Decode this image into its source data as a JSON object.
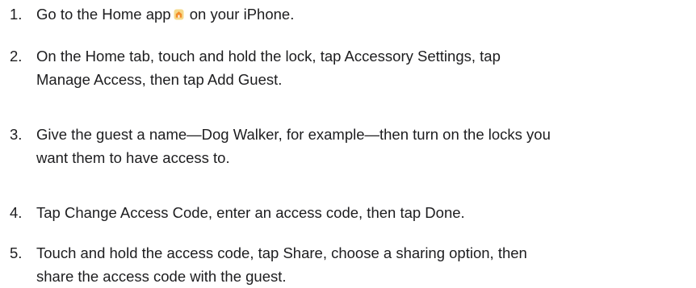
{
  "steps": [
    {
      "number": "1.",
      "text_before_icon": "Go to the Home app",
      "icon": "home-app-icon",
      "text_after_icon": "on your iPhone."
    },
    {
      "number": "2.",
      "line1": "On the Home tab, touch and hold the lock, tap Accessory Settings, tap",
      "line2": "Manage Access, then tap Add Guest."
    },
    {
      "number": "3.",
      "line1": "Give the guest a name—Dog Walker, for example—then turn on the locks you",
      "line2": "want them to have access to."
    },
    {
      "number": "4.",
      "line1": "Tap Change Access Code, enter an access code, then tap Done."
    },
    {
      "number": "5.",
      "line1": "Touch and hold the access code, tap Share, choose a sharing option, then",
      "line2": "share the access code with the guest."
    }
  ],
  "colors": {
    "text": "#1d1d1f",
    "icon_bg": "#f5d98a",
    "icon_house": "#f28c28"
  }
}
